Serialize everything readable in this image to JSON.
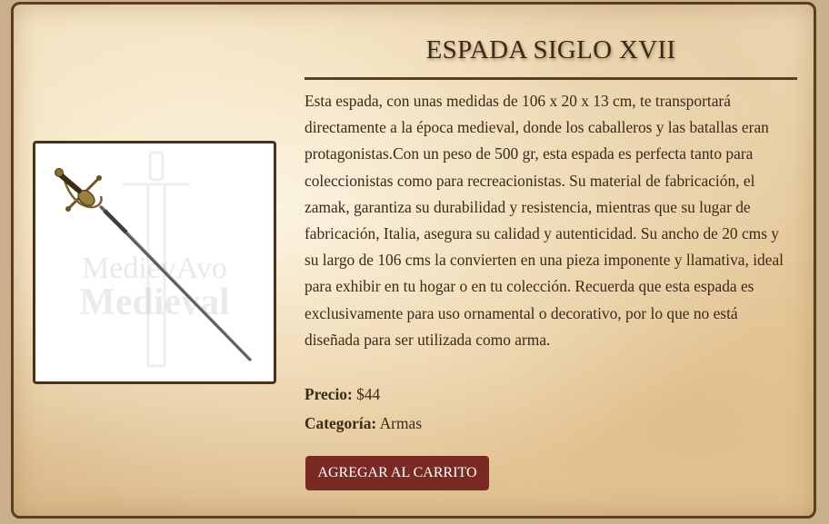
{
  "product": {
    "title": "ESPADA SIGLO XVII",
    "image_alt": "Espada Siglo XVII",
    "description": "Esta espada, con unas medidas de 106 x 20 x 13 cm, te transportará directamente a la época medieval, donde los caballeros y las batallas eran protagonistas.Con un peso de 500 gr, esta espada es perfecta tanto para coleccionistas como para recreacionistas. Su material de fabricación, el zamak, garantiza su durabilidad y resistencia, mientras que su lugar de fabricación, Italia, asegura su calidad y autenticidad. Su ancho de 20 cms y su largo de 106 cms la convierten en una pieza imponente y llamativa, ideal para exhibir en tu hogar o en tu colección. Recuerda que esta espada es exclusivamente para uso ornamental o decorativo, por lo que no está diseñada para ser utilizada como arma.",
    "price_label": "Precio:",
    "price_value": "$44",
    "category_label": "Categoría:",
    "category_value": "Armas",
    "cart_button": "AGREGAR AL CARRITO"
  },
  "watermark": {
    "line1": "MedievAvo",
    "line2": "Medieval"
  },
  "colors": {
    "accent": "#7b2a23",
    "border": "#5b3d1f",
    "text": "#3a2a18"
  }
}
